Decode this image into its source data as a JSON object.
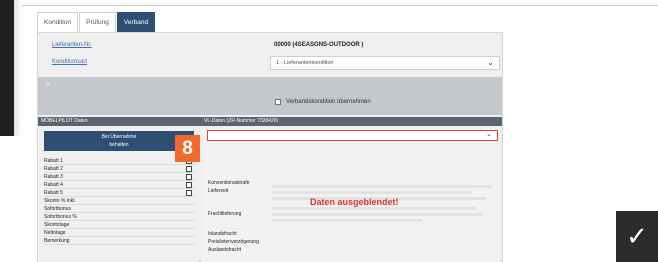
{
  "tabs": [
    {
      "label": "Kondition",
      "active": false
    },
    {
      "label": "Prüfung",
      "active": false
    },
    {
      "label": "Verband",
      "active": true
    }
  ],
  "supplier": {
    "label": "Lieferanten-Nr.",
    "value": "00000 (4SEASONS-OUTDOOR )"
  },
  "condition": {
    "label": "Konditionsart",
    "value": "1 - Lieferantenkondition"
  },
  "band": {
    "arrow": ">"
  },
  "checkbox": {
    "label": "Verbandskondition übernehmen"
  },
  "sections": {
    "left": "MÖBELPILOT Daten",
    "right": "VL-Daten (ZR-Nummer 7328420)"
  },
  "left_header": {
    "line1": "Bei Übernahme",
    "line2": "behalten"
  },
  "left_items": [
    "Rabatt 1",
    "Rabatt 2",
    "Rabatt 3",
    "Rabatt 4",
    "Rabatt 5",
    "Skonto % inkl.",
    "Sofortbonus",
    "Sofortbonus %",
    "Skontotage",
    "Nettotage",
    "Bemerkung"
  ],
  "right_labels": [
    "Konventionalstrafe",
    "Lieferzeit",
    "Frachtlieferung",
    "Inlandsfracht",
    "Preislistenverzögerung",
    "Auslandsfracht"
  ],
  "hidden_message": "Daten ausgeblendet!",
  "step_badge": "8",
  "confirm_icon": "✓",
  "colors": {
    "accent": "#2f4e73",
    "highlight": "#e0413a",
    "badge": "#f06a2e",
    "dark": "#2b2b2b"
  }
}
